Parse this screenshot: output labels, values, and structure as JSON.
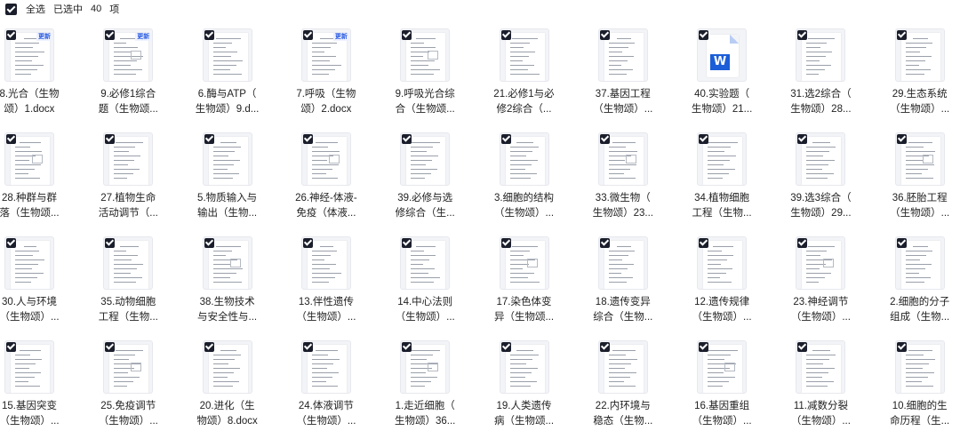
{
  "header": {
    "select_all_label": "全选",
    "selected_prefix": "已选中",
    "selected_count": "40",
    "selected_suffix": "项"
  },
  "colors": {
    "checkbox": "#1b1e2b",
    "badge": "#2f5fe0",
    "word_blue": "#1c5ed8"
  },
  "files": [
    [
      {
        "line1": "8.光合（生物",
        "line2": "颂）1.docx",
        "badge": "更新"
      },
      {
        "line1": "9.必修1综合",
        "line2": "题（生物颂...",
        "badge": "更新"
      },
      {
        "line1": "6.酶与ATP（",
        "line2": "生物颂）9.d..."
      },
      {
        "line1": "7.呼吸（生物",
        "line2": "颂）2.docx",
        "badge": "更新"
      },
      {
        "line1": "9.呼吸光合综",
        "line2": "合（生物颂..."
      },
      {
        "line1": "21.必修1与必",
        "line2": "修2综合（..."
      },
      {
        "line1": "37.基因工程",
        "line2": "（生物颂）..."
      },
      {
        "line1": "40.实验题（",
        "line2": "生物颂）21...",
        "word": "W"
      },
      {
        "line1": "31.选2综合（",
        "line2": "生物颂）28..."
      },
      {
        "line1": "29.生态系统",
        "line2": "（生物颂）..."
      }
    ],
    [
      {
        "line1": "28.种群与群",
        "line2": "落（生物颂..."
      },
      {
        "line1": "27.植物生命",
        "line2": "活动调节（..."
      },
      {
        "line1": "5.物质输入与",
        "line2": "输出（生物..."
      },
      {
        "line1": "26.神经-体液-",
        "line2": "免疫（体液..."
      },
      {
        "line1": "39.必修与选",
        "line2": "修综合（生..."
      },
      {
        "line1": "3.细胞的结构",
        "line2": "（生物颂）..."
      },
      {
        "line1": "33.微生物（",
        "line2": "生物颂）23..."
      },
      {
        "line1": "34.植物细胞",
        "line2": "工程（生物..."
      },
      {
        "line1": "39.选3综合（",
        "line2": "生物颂）29..."
      },
      {
        "line1": "36.胚胎工程",
        "line2": "（生物颂）..."
      }
    ],
    [
      {
        "line1": "30.人与环境",
        "line2": "（生物颂）..."
      },
      {
        "line1": "35.动物细胞",
        "line2": "工程（生物..."
      },
      {
        "line1": "38.生物技术",
        "line2": "与安全性与..."
      },
      {
        "line1": "13.伴性遗传",
        "line2": "（生物颂）..."
      },
      {
        "line1": "14.中心法则",
        "line2": "（生物颂）..."
      },
      {
        "line1": "17.染色体变",
        "line2": "异（生物颂..."
      },
      {
        "line1": "18.遗传变异",
        "line2": "综合（生物..."
      },
      {
        "line1": "12.遗传规律",
        "line2": "（生物颂）..."
      },
      {
        "line1": "23.神经调节",
        "line2": "（生物颂）..."
      },
      {
        "line1": "2.细胞的分子",
        "line2": "组成（生物..."
      }
    ],
    [
      {
        "line1": "15.基因突变",
        "line2": "（生物颂）..."
      },
      {
        "line1": "25.免疫调节",
        "line2": "（生物颂）..."
      },
      {
        "line1": "20.进化（生",
        "line2": "物颂）8.docx"
      },
      {
        "line1": "24.体液调节",
        "line2": "（生物颂）..."
      },
      {
        "line1": "1.走近细胞（",
        "line2": "生物颂）36..."
      },
      {
        "line1": "19.人类遗传",
        "line2": "病（生物颂..."
      },
      {
        "line1": "22.内环境与",
        "line2": "稳态（生物..."
      },
      {
        "line1": "16.基因重组",
        "line2": "（生物颂）..."
      },
      {
        "line1": "11.减数分裂",
        "line2": "（生物颂）..."
      },
      {
        "line1": "10.细胞的生",
        "line2": "命历程（生..."
      }
    ]
  ]
}
